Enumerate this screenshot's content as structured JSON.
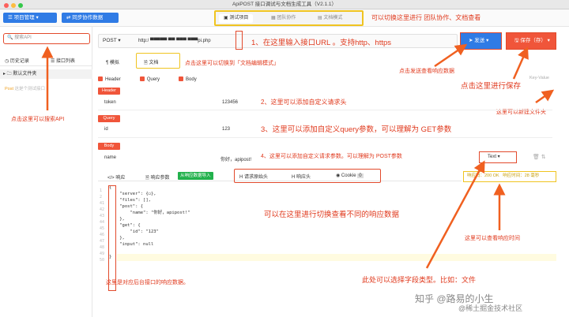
{
  "window": {
    "title": "ApiPOST 接口调试与文档生成工具（V2.1.1）"
  },
  "topbar": {
    "project_button": "项目管理",
    "sync_button": "同步协作数据",
    "modes": [
      "测试项目",
      "团队协作",
      "文档模式"
    ]
  },
  "sidebar": {
    "search_placeholder": "搜索API",
    "tabs": [
      "历史记录",
      "接口列表"
    ],
    "folder": "默认文件夹",
    "item": "这是个测试接口"
  },
  "request": {
    "method": "POST",
    "url": "http:/ ▀▀▀▀▀ ▀▀ ▀▀▀ ▀▀▀pi.php",
    "send_label": "发送",
    "save_label": "保存（存）",
    "tabs": [
      "模拟",
      "文档"
    ],
    "checks": [
      "Header",
      "Query",
      "Body"
    ],
    "header": {
      "label": "Header",
      "key": "token",
      "value": "123456"
    },
    "query": {
      "label": "Query",
      "key": "id",
      "value": "123"
    },
    "body": {
      "label": "Body",
      "key": "name",
      "value": "你好，apipost!"
    },
    "body_type": "Text",
    "keyvalue_label": "Key-Value"
  },
  "response": {
    "tabs": [
      "响应",
      "响应参数"
    ],
    "import_label": "从响应数据导入",
    "header_tabs": [
      "请求原始头",
      "响应头",
      "Cookie"
    ],
    "cookie_count": "0",
    "status": "响应码：200 OK",
    "time": "响应时间：28 毫秒",
    "code_lines": [
      "{",
      "    \"server\": {▭},",
      "    \"files\": [],",
      "    \"post\": {",
      "        \"name\": \"你好，apipost!\"",
      "    },",
      "    \"get\": {",
      "        \"id\": \"123\"",
      "    },",
      "    \"input\": null",
      "",
      "}"
    ],
    "gutter": [
      "1",
      "2",
      "41",
      "42",
      "43",
      "44",
      "45",
      "46",
      "47",
      "48",
      "49",
      "50"
    ]
  },
  "annotations": {
    "mode_switch": "可以切换这里进行 团队协作、文档查看",
    "url_hint": "1、在这里输入接口URL 。支持http、https",
    "doc_switch": "点击这里可以切换到「文档编辑模式」",
    "send_hint": "点击发送查看响应数据",
    "save_hint": "点击这里进行保存",
    "new_folder": "这里可以新建文件夹",
    "search_hint": "点击这里可以搜索API",
    "header_hint": "2、这里可以添加自定义请求头",
    "query_hint": "3、这里可以添加自定义query参数，可以理解为 GET参数",
    "body_hint": "4、这里可以添加自定义请求参数。可以理解为 POST参数",
    "resp_switch": "可以在这里进行切换查看不同的响应数据",
    "resp_time": "这里可以查看响应时间",
    "field_type": "此处可以选择字段类型。比如：文件",
    "backend_data": "这里是对应后台接口的响应数据。"
  },
  "watermark": {
    "line1": "知乎 @路易的小生",
    "line2": "@稀土掘金技术社区"
  }
}
